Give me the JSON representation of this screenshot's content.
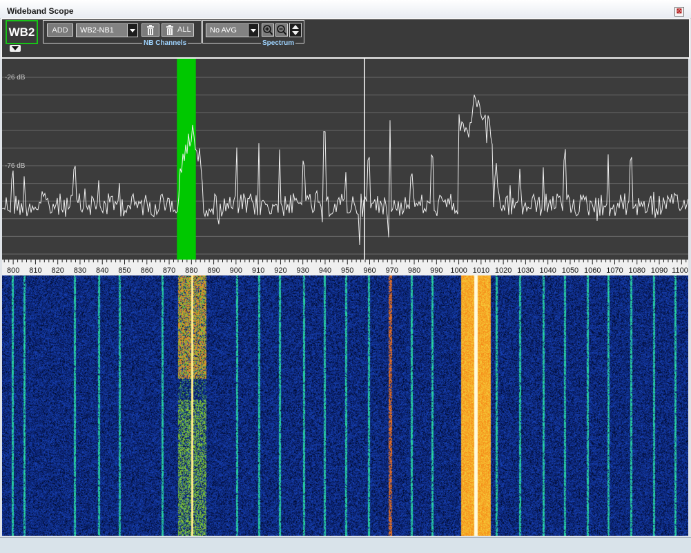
{
  "window": {
    "title": "Wideband Scope",
    "close_glyph": "⊠"
  },
  "toolbar": {
    "wb_label": "WB2",
    "nb_channels": {
      "add_label": "ADD",
      "channel_select": "WB2-NB1",
      "delete_all_label": "ALL",
      "group_label": "NB Channels"
    },
    "spectrum": {
      "avg_select": "No AVG",
      "group_label": "Spectrum"
    }
  },
  "spectrum_view": {
    "db_labels": [
      "-26 dB",
      "-76 dB"
    ],
    "background": "#3c3c3c",
    "trace_color": "#f0f0f0",
    "channel_highlight_color": "#00cc00",
    "channel_highlight_range": [
      873.5,
      882
    ]
  },
  "frequency_axis": {
    "ticks": [
      "800",
      "810",
      "820",
      "830",
      "840",
      "850",
      "860",
      "870",
      "880",
      "890",
      "900",
      "910",
      "920",
      "930",
      "940",
      "950",
      "960",
      "970",
      "980",
      "990",
      "1000",
      "1010",
      "1020",
      "1030",
      "1040",
      "1050",
      "1060",
      "1070",
      "1080",
      "1090",
      "1100"
    ]
  },
  "waterfall": {
    "colors": {
      "low": "#0d1f6e",
      "mid": "#2cc8c8",
      "high": "#ff8c00",
      "peak": "#ffffff"
    }
  }
}
